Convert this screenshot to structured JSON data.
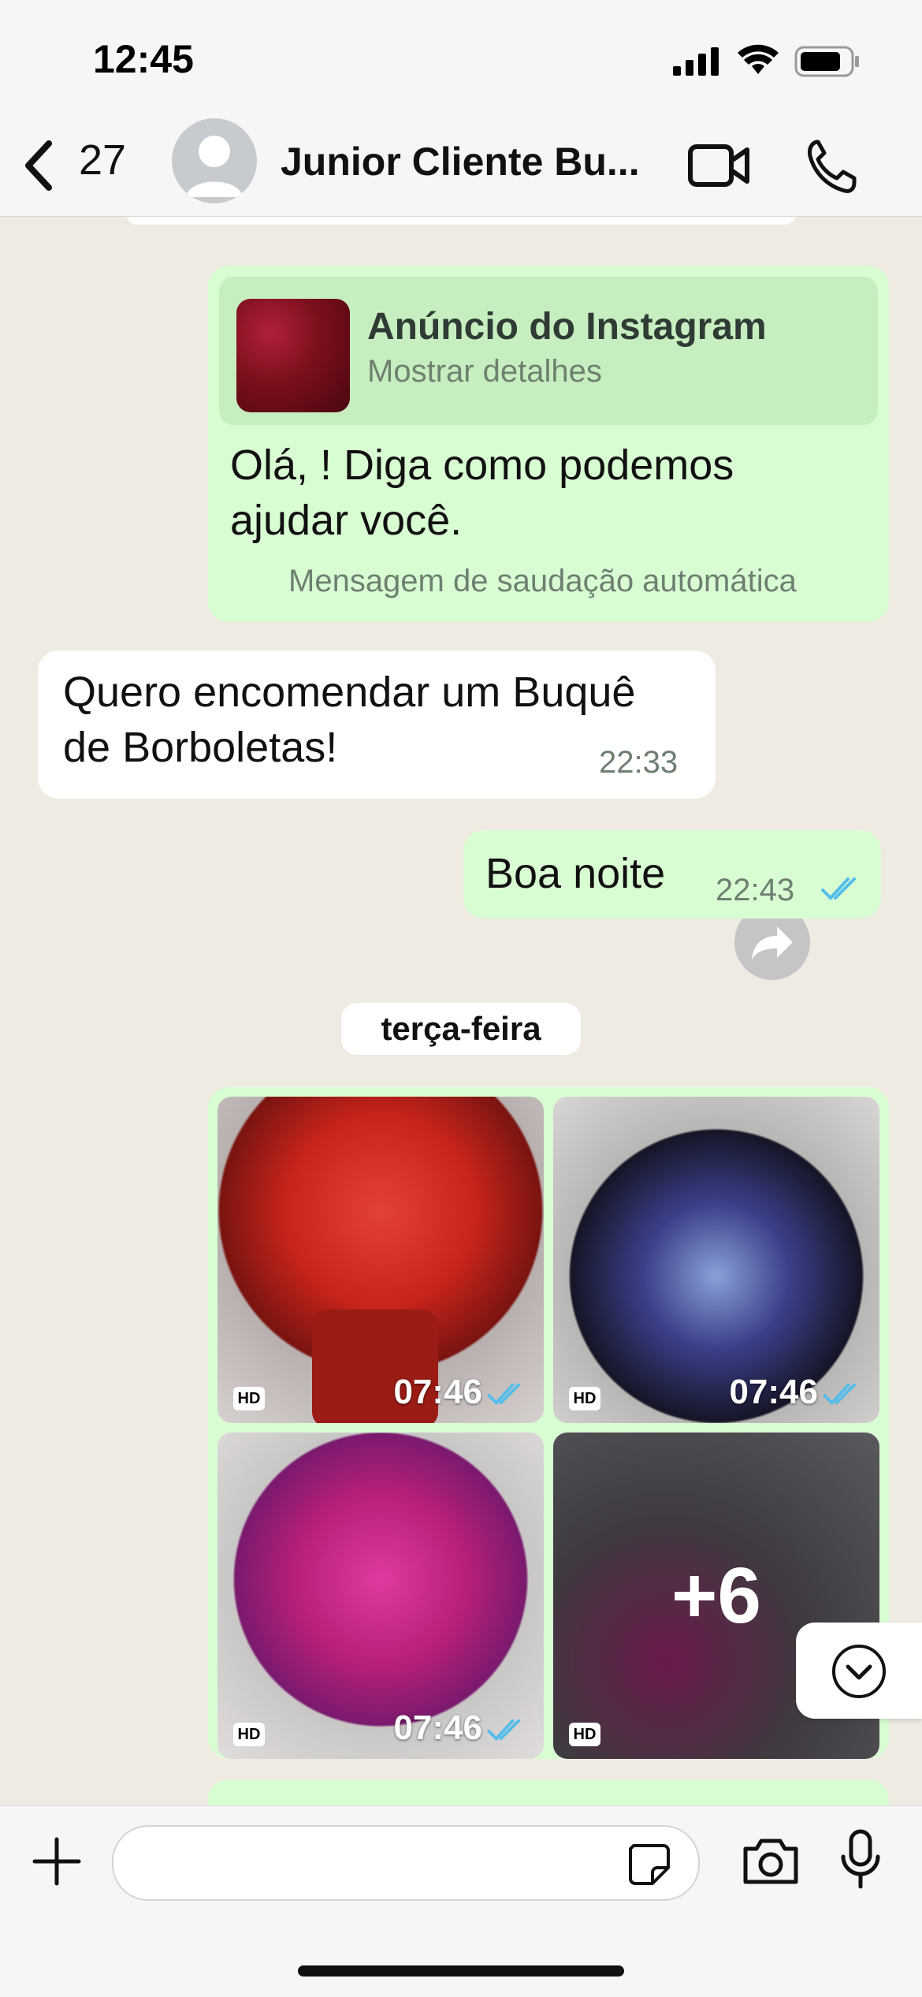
{
  "status_bar": {
    "time": "12:45"
  },
  "header": {
    "back_count": "27",
    "contact_name": "Junior Cliente Bu..."
  },
  "messages": {
    "ad_title": "Anúncio do Instagram",
    "ad_subtitle": "Mostrar detalhes",
    "greeting_line1": "Olá, ! Diga como podemos",
    "greeting_line2": "ajudar você.",
    "greeting_footer": "Mensagem de saudação automática",
    "incoming_line1": "Quero encomendar um Buquê",
    "incoming_line2": "de Borboletas!",
    "incoming_time": "22:33",
    "outgoing_text": "Boa noite",
    "outgoing_time": "22:43"
  },
  "date_separator": "terça-feira",
  "photos": [
    {
      "time": "07:46",
      "hd": "HD"
    },
    {
      "time": "07:46",
      "hd": "HD"
    },
    {
      "time": "07:46",
      "hd": "HD"
    },
    {
      "more": "+6",
      "hd": "HD"
    }
  ],
  "colors": {
    "outgoing_bubble": "#d9fdd3",
    "incoming_bubble": "#ffffff",
    "read_ticks": "#53bdeb",
    "chat_background": "#efeae2"
  },
  "icons": [
    "chevron-left-icon",
    "video-call-icon",
    "phone-icon",
    "forward-icon",
    "scroll-down-icon",
    "plus-icon",
    "sticker-icon",
    "camera-icon",
    "microphone-icon"
  ]
}
